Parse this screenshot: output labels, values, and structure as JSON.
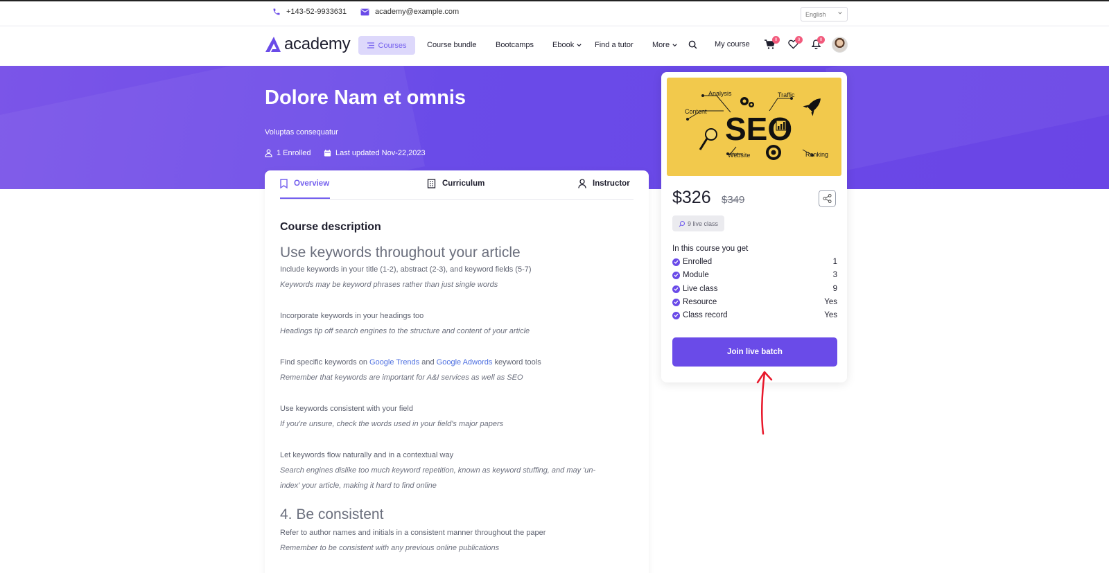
{
  "topbar": {
    "phone": "+143-52-9933631",
    "email": "academy@example.com",
    "language": "English"
  },
  "nav": {
    "logo": "academy",
    "courses": "Courses",
    "items": [
      "Course bundle",
      "Bootcamps",
      "Ebook",
      "Find a tutor",
      "More"
    ],
    "my_course": "My course",
    "cart_count": "0",
    "wishlist_count": "0",
    "notification_count": "0"
  },
  "hero": {
    "title": "Dolore Nam et omnis",
    "subtitle": "Voluptas consequatur",
    "enrolled": "1 Enrolled",
    "last_updated": "Last updated Nov-22,2023"
  },
  "tabs": [
    "Overview",
    "Curriculum",
    "Instructor"
  ],
  "content": {
    "heading": "Course description",
    "section1_title": "Use keywords throughout your article",
    "lines": [
      "Include keywords in your title (1-2), abstract (2-3), and keyword fields (5-7)",
      "Keywords may be keyword phrases rather than just single words",
      "Incorporate keywords in your headings too",
      "Headings tip off search engines to the structure and content of your article",
      "Find specific keywords on",
      "Google Trends",
      "and",
      "Google Adwords",
      "keyword tools",
      "Remember that keywords are important for A&I services as well as SEO",
      "Use keywords consistent with your field",
      "If you're unsure, check the words used in your field's major papers",
      "Let keywords flow naturally and in a contextual way",
      "Search engines dislike too much keyword repetition, known as keyword stuffing, and may 'un-",
      "index' your article, making it hard to find online"
    ],
    "section2_title": "4. Be consistent",
    "section2_lines": [
      "Refer to author names and initials in a consistent manner throughout the paper",
      "Remember to be consistent with any previous online publications"
    ]
  },
  "sidebar": {
    "image_labels": [
      "Analysis",
      "Traffic",
      "Content",
      "SEO",
      "Website",
      "Ranking"
    ],
    "price": "$326",
    "old_price": "$349",
    "live_chip": "9 live class",
    "get_heading": "In this course you get",
    "features": [
      {
        "label": "Enrolled",
        "value": "1"
      },
      {
        "label": "Module",
        "value": "3"
      },
      {
        "label": "Live class",
        "value": "9"
      },
      {
        "label": "Resource",
        "value": "Yes"
      },
      {
        "label": "Class record",
        "value": "Yes"
      }
    ],
    "join_button": "Join live batch"
  },
  "colors": {
    "primary": "#6a4be8",
    "accent_light": "#ddd8fb",
    "badge": "#f25a7c",
    "arrow": "#e8182b"
  }
}
